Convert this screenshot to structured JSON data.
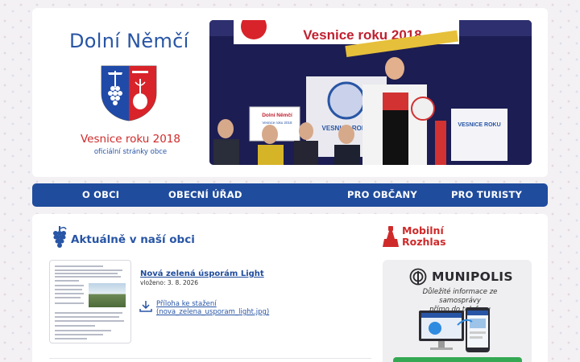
{
  "header": {
    "title": "Dolní Němčí",
    "subtitle": "Vesnice roku 2018",
    "tagline": "oficiální stránky obce"
  },
  "hero": {
    "banner_text": "Vesnice roku 2018",
    "sign_left": "Dolní Němčí",
    "sign_left_sub": "Vesnice roku 2018",
    "sign_mid": "VESNICE ROKU",
    "sign_right": "VESNICE ROKU"
  },
  "nav": {
    "items": [
      {
        "label": "O OBCI"
      },
      {
        "label": "OBECNÍ ÚŘAD"
      },
      {
        "label": "PRO OBČANY"
      },
      {
        "label": "PRO TURISTY"
      }
    ]
  },
  "news": {
    "section_title": "Aktuálně v naší obci",
    "items": [
      {
        "title": "Nová zelená úsporám Light",
        "date": "vloženo: 3. 8. 2026",
        "attachment_label": "Příloha ke stažení",
        "attachment_file": "(nova_zelena_usporam_light.jpg)"
      }
    ]
  },
  "rozhlas": {
    "title_line1": "Mobilní",
    "title_line2": "Rozhlas"
  },
  "munipolis": {
    "brand": "MUNIPOLIS",
    "desc_line1": "Důležité informace ze samosprávy",
    "desc_line2": "přímo do telefonu"
  },
  "colors": {
    "primary_blue": "#1f4c9d",
    "accent_red": "#cf2a2a",
    "munipolis_green": "#35a853"
  }
}
